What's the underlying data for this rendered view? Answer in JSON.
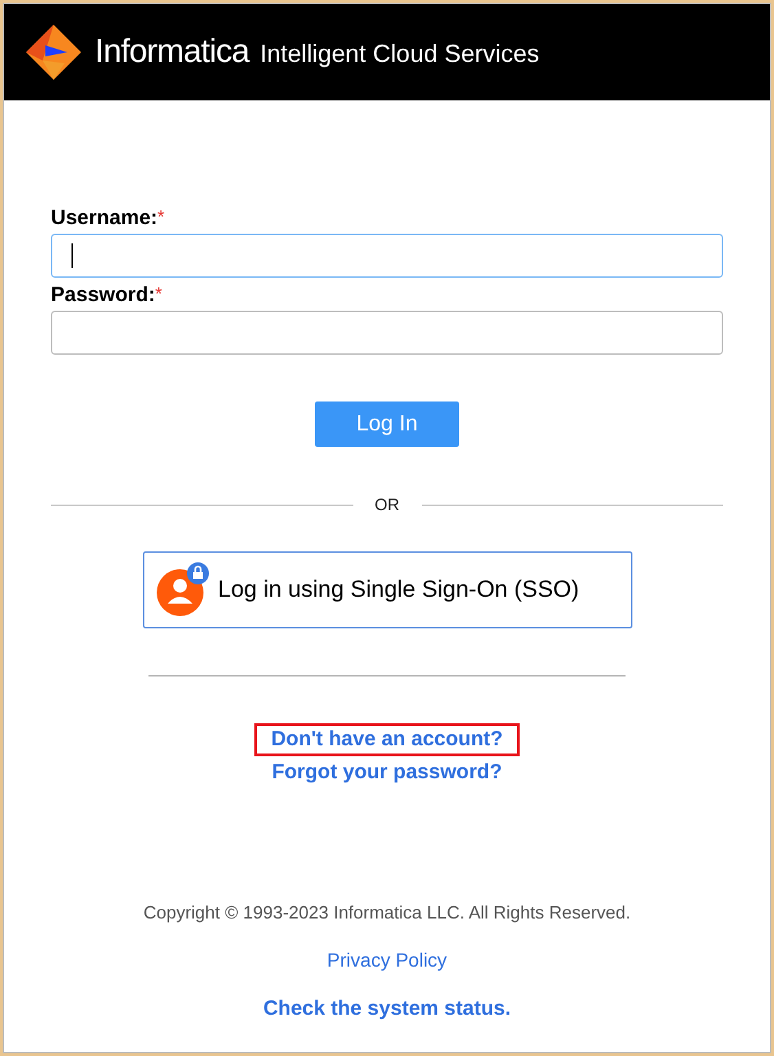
{
  "header": {
    "brand": "Informatica",
    "product": "Intelligent Cloud Services"
  },
  "fields": [
    {
      "label": "Username:",
      "required_mark": "*",
      "focused": true
    },
    {
      "label": "Password:",
      "required_mark": "*",
      "focused": false
    }
  ],
  "login_button": "Log In",
  "separator": "OR",
  "sso_button": "Log in using Single Sign-On (SSO)",
  "links": [
    {
      "text": "Don't have an account?",
      "highlighted": true
    },
    {
      "text": "Forgot your password?",
      "highlighted": false
    }
  ],
  "footer": {
    "copyright": "Copyright © 1993-2023 Informatica LLC. All Rights Reserved.",
    "privacy": "Privacy Policy",
    "status": "Check the system status."
  }
}
